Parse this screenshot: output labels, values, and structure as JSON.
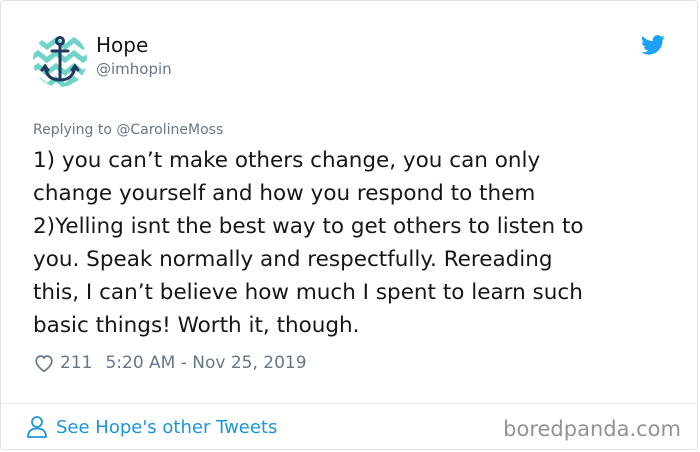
{
  "author": {
    "name": "Hope",
    "handle": "@imhopin"
  },
  "reply_to": "Replying to @CarolineMoss",
  "tweet_text": "1) you can’t make others change, you can only\nchange yourself and how you respond to them\n2)Yelling isnt the best way to get others to listen to\nyou. Speak normally and respectfully. Rereading\nthis, I can’t believe how much I spent to learn such\nbasic things! Worth it, though.",
  "likes": "211",
  "timestamp": "5:20 AM - Nov 25, 2019",
  "footer": {
    "link_label": "See Hope's other Tweets"
  },
  "watermark": "boredpanda.com",
  "icons": {
    "avatar": "anchor-avatar",
    "brand": "twitter-bird-icon",
    "like": "heart-icon",
    "profile": "person-icon"
  },
  "colors": {
    "twitter_blue": "#1da1f2",
    "link_blue": "#1b95e0",
    "muted": "#657786",
    "avatar_teal": "#6fd3c8",
    "anchor_navy": "#1f3a5c"
  }
}
